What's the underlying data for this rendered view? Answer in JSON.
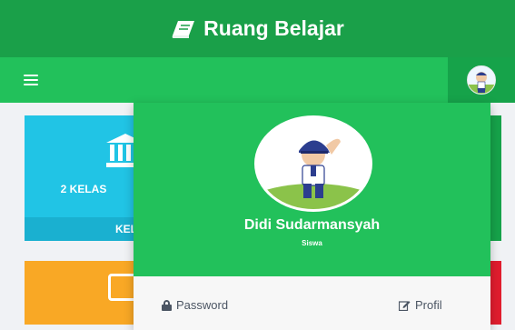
{
  "app": {
    "title": "Ruang Belajar",
    "brand_icon": "book-icon"
  },
  "navbar": {
    "menu_icon": "hamburger-icon",
    "avatar_icon": "avatar-icon"
  },
  "tiles": {
    "primary": {
      "count_label": "2 KELAS",
      "footer_label": "KEL",
      "icon": "institution-icon",
      "color": "#21c4e5"
    },
    "secondary": {
      "icon": "edit-icon",
      "color": "#f9a825"
    }
  },
  "user_menu": {
    "name": "Didi Sudarmansyah",
    "role": "Siswa",
    "password_label": "Password",
    "profile_label": "Profil"
  },
  "colors": {
    "header": "#1aa049",
    "navbar": "#22c15b",
    "accent_green": "#16a34a",
    "accent_red": "#e11d2e"
  }
}
